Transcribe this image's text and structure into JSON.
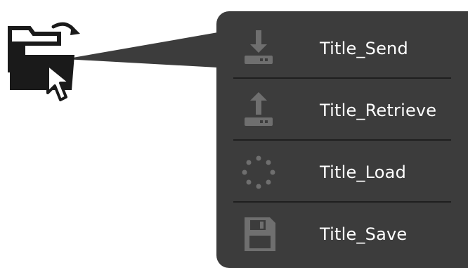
{
  "menu": {
    "items": [
      {
        "label": "Title_Send",
        "icon": "send-download-icon"
      },
      {
        "label": "Title_Retrieve",
        "icon": "retrieve-upload-icon"
      },
      {
        "label": "Title_Load",
        "icon": "loading-spinner-icon"
      },
      {
        "label": "Title_Save",
        "icon": "floppy-disk-icon"
      }
    ]
  },
  "trigger": {
    "icon": "folder-with-cursor-icon"
  },
  "colors": {
    "panel": "#3c3c3c",
    "divider": "#1f1f1f",
    "icon_gray": "#6f6f6f",
    "label": "#ffffff",
    "folder": "#1a1a1a"
  }
}
